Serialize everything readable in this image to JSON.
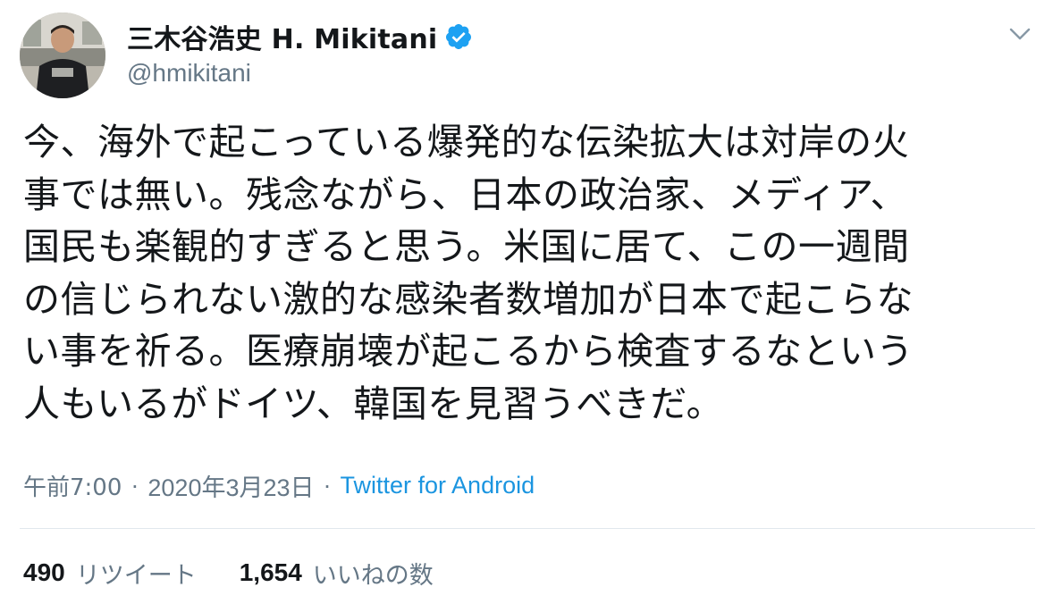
{
  "tweet": {
    "author": {
      "display_name": "三木谷浩史 H. Mikitani",
      "handle": "@hmikitani",
      "verified": true
    },
    "text": "今、海外で起こっている爆発的な伝染拡大は対岸の火\n事では無い。残念ながら、日本の政治家、メディア、\n国民も楽観的すぎると思う。米国に居て、この一週間\nの信じられない激的な感染者数増加が日本で起こらな\nい事を祈る。医療崩壊が起こるから検査するなという\n人もいるがドイツ、韓国を見習うべきだ。",
    "time": "午前7:00",
    "separator": "·",
    "date": "2020年3月23日",
    "source": "Twitter for Android",
    "stats": {
      "retweets_count": "490",
      "retweets_label": "リツイート",
      "likes_count": "1,654",
      "likes_label": "いいねの数"
    }
  },
  "icons": {
    "verified": "verified-badge-icon",
    "menu": "chevron-down-icon"
  },
  "colors": {
    "text": "#14171a",
    "secondary": "#657786",
    "link": "#1b95e0",
    "verified": "#1da1f2",
    "divider": "#e1e8ed"
  }
}
